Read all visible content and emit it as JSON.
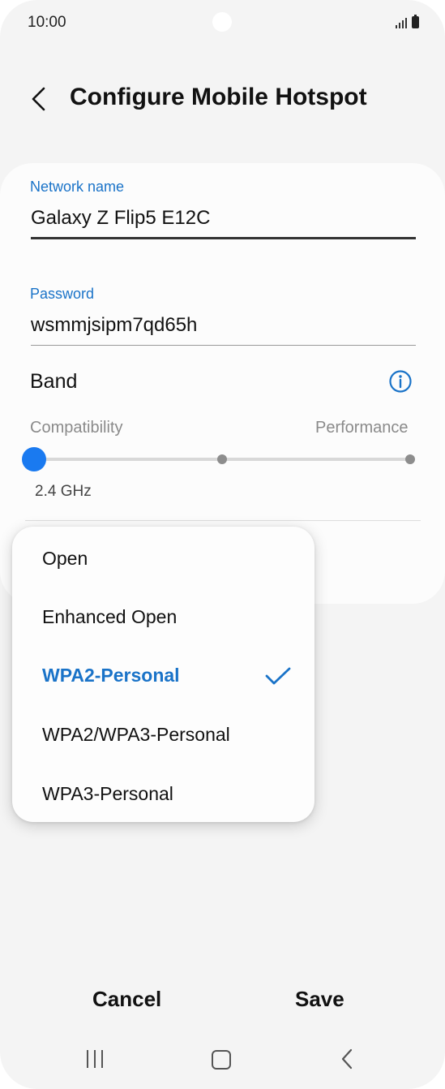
{
  "status_bar": {
    "time": "10:00"
  },
  "header": {
    "title": "Configure Mobile Hotspot"
  },
  "form": {
    "network_name_label": "Network name",
    "network_name_value": "Galaxy Z Flip5 E12C",
    "password_label": "Password",
    "password_value": "wsmmjsipm7qd65h",
    "band_label": "Band",
    "compatibility_label": "Compatibility",
    "performance_label": "Performance",
    "band_value": "2.4 GHz",
    "band_slider_position": 0
  },
  "security_dropdown": {
    "options": [
      {
        "label": "Open",
        "selected": false
      },
      {
        "label": "Enhanced Open",
        "selected": false
      },
      {
        "label": "WPA2-Personal",
        "selected": true
      },
      {
        "label": "WPA2/WPA3-Personal",
        "selected": false
      },
      {
        "label": "WPA3-Personal",
        "selected": false
      }
    ]
  },
  "actions": {
    "cancel_label": "Cancel",
    "save_label": "Save"
  },
  "colors": {
    "accent": "#1a73c8",
    "slider_thumb": "#1a7af0",
    "background": "#f4f4f4"
  },
  "icons": [
    "back-arrow-icon",
    "info-icon",
    "check-icon",
    "recents-icon",
    "home-icon",
    "nav-back-icon",
    "signal-icon",
    "battery-icon"
  ]
}
